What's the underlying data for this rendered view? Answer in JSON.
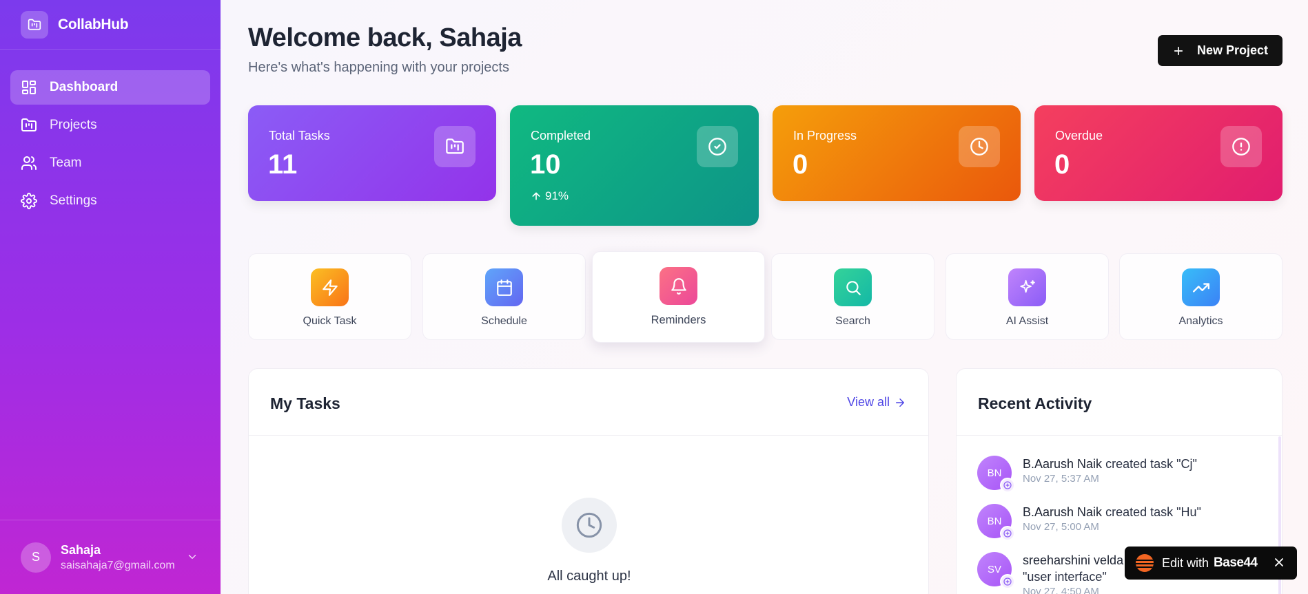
{
  "app": {
    "name": "CollabHub"
  },
  "sidebar": {
    "items": [
      {
        "label": "Dashboard",
        "icon": "dashboard-icon",
        "active": true
      },
      {
        "label": "Projects",
        "icon": "folder-kanban-icon"
      },
      {
        "label": "Team",
        "icon": "users-icon"
      },
      {
        "label": "Settings",
        "icon": "gear-icon"
      }
    ],
    "user": {
      "initial": "S",
      "name": "Sahaja",
      "email": "saisahaja7@gmail.com"
    }
  },
  "header": {
    "title": "Welcome back, Sahaja",
    "subtitle": "Here's what's happening with your projects",
    "new_project_label": "New Project"
  },
  "stats": [
    {
      "label": "Total Tasks",
      "value": "11",
      "icon": "folder-kanban-icon",
      "color": "#8b5cf6"
    },
    {
      "label": "Completed",
      "value": "10",
      "trend": "91%",
      "icon": "check-circle-icon",
      "color": "#10b981"
    },
    {
      "label": "In Progress",
      "value": "0",
      "icon": "clock-icon",
      "color": "#f59e0b"
    },
    {
      "label": "Overdue",
      "value": "0",
      "icon": "alert-circle-icon",
      "color": "#f43f5e"
    }
  ],
  "quick_actions": [
    {
      "label": "Quick Task",
      "icon": "lightning-icon",
      "color": "#f59e0b"
    },
    {
      "label": "Schedule",
      "icon": "calendar-icon",
      "color": "#6366f1"
    },
    {
      "label": "Reminders",
      "icon": "bell-icon",
      "color": "#f43f5e"
    },
    {
      "label": "Search",
      "icon": "search-icon",
      "color": "#10b981"
    },
    {
      "label": "AI Assist",
      "icon": "sparkles-icon",
      "color": "#a855f7"
    },
    {
      "label": "Analytics",
      "icon": "trending-up-icon",
      "color": "#0ea5e9"
    }
  ],
  "my_tasks": {
    "title": "My Tasks",
    "view_all": "View all",
    "empty_text": "All caught up!"
  },
  "recent_activity": {
    "title": "Recent Activity",
    "items": [
      {
        "initials": "BN",
        "actor": "B.Aarush Naik",
        "action": "created task \"Cj\"",
        "time": "Nov 27, 5:37 AM"
      },
      {
        "initials": "BN",
        "actor": "B.Aarush Naik",
        "action": "created task \"Hu\"",
        "time": "Nov 27, 5:00 AM"
      },
      {
        "initials": "SV",
        "actor": "sreeharshini velda",
        "action": "\"user interface\"",
        "time": "Nov 27, 4:50 AM"
      }
    ]
  },
  "badge": {
    "text": "Edit with",
    "brand": "Base44"
  }
}
